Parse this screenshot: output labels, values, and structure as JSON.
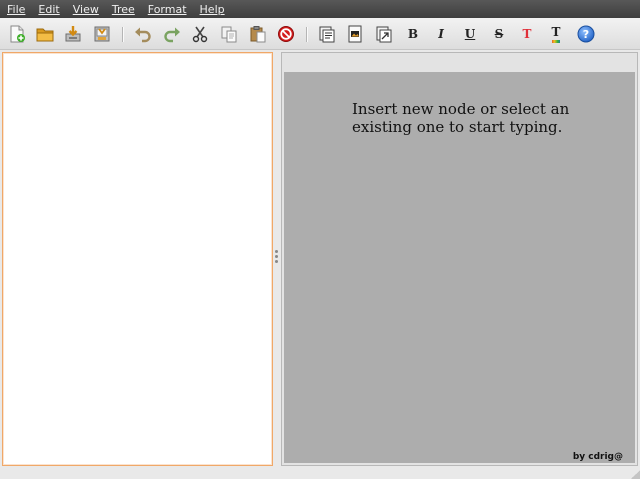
{
  "menubar": {
    "items": [
      "File",
      "Edit",
      "View",
      "Tree",
      "Format",
      "Help"
    ]
  },
  "toolbar": {
    "bold_glyph": "B",
    "italic_glyph": "I",
    "underline_glyph": "U",
    "strike_glyph": "S",
    "text_color_glyph": "T",
    "highlight_glyph": "T",
    "help_glyph": "?",
    "icons": [
      "new-file-icon",
      "open-folder-icon",
      "save-icon",
      "save-as-icon",
      "undo-icon",
      "redo-icon",
      "cut-icon",
      "copy-icon",
      "paste-icon",
      "delete-icon",
      "insert-node-icon",
      "insert-image-icon",
      "insert-link-icon",
      "bold-icon",
      "italic-icon",
      "underline-icon",
      "strikethrough-icon",
      "text-color-icon",
      "highlight-color-icon",
      "help-icon"
    ]
  },
  "editor": {
    "hint_text": "Insert new node or select an existing one to start typing.",
    "credit": "by cdrig@"
  },
  "colors": {
    "menubar_bg": "#4a4a4a",
    "tree_border": "#f0a868",
    "editor_bg": "#adadad",
    "text_color_icon": "#e0303a",
    "help_blue": "#2a6fd0",
    "delete_red": "#d41c1c"
  }
}
